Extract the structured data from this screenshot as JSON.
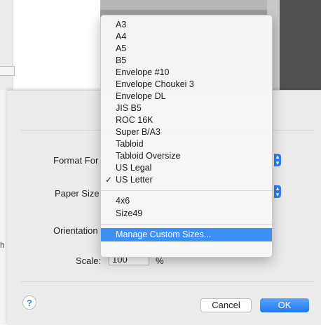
{
  "paper_sizes": [
    "A3",
    "A4",
    "A5",
    "B5",
    "Envelope #10",
    "Envelope Choukei 3",
    "Envelope DL",
    "JIS B5",
    "ROC 16K",
    "Super B/A3",
    "Tabloid",
    "Tabloid Oversize",
    "US Legal",
    "US Letter"
  ],
  "selected_paper": "US Letter",
  "check_mark": "✓",
  "custom_sizes": [
    "4x6",
    "Size49"
  ],
  "manage_label": "Manage Custom Sizes...",
  "dialog": {
    "format_for_label": "Format For",
    "paper_size_label": "Paper Size",
    "orientation_label": "Orientation",
    "scale_label": "Scale:",
    "scale_value": "100",
    "scale_unit": "%",
    "help_label": "?",
    "cancel_label": "Cancel",
    "ok_label": "OK"
  },
  "background": {
    "edge_mark": "h"
  },
  "colors": {
    "accent": "#3d8ff6",
    "ok": "#2f80f4"
  }
}
